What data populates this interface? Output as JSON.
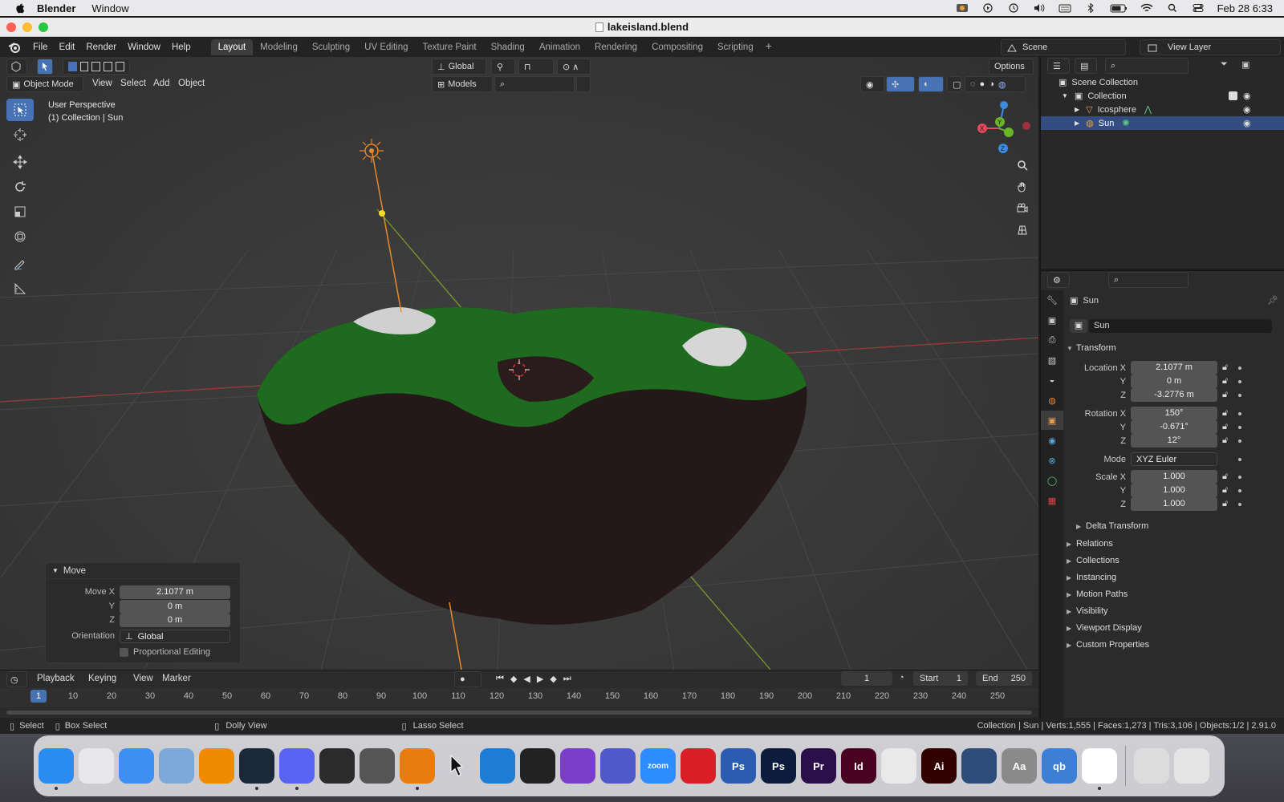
{
  "menubar": {
    "app_name": "Blender",
    "menus": [
      "Window"
    ],
    "clock": "Feb 28  6:33",
    "icons": [
      "flux-icon",
      "play-circle-icon",
      "time-machine-icon",
      "volume-icon",
      "keyboard-icon",
      "bluetooth-icon",
      "battery-icon",
      "wifi-icon",
      "search-icon",
      "control-center-icon"
    ]
  },
  "window": {
    "title": "lakeisland.blend"
  },
  "topbar": {
    "menus": [
      "File",
      "Edit",
      "Render",
      "Window",
      "Help"
    ],
    "workspaces": [
      "Layout",
      "Modeling",
      "Sculpting",
      "UV Editing",
      "Texture Paint",
      "Shading",
      "Animation",
      "Rendering",
      "Compositing",
      "Scripting"
    ],
    "active_workspace": "Layout",
    "scene": "Scene",
    "view_layer": "View Layer"
  },
  "viewport": {
    "mode": "Object Mode",
    "menus": [
      "View",
      "Select",
      "Add",
      "Object"
    ],
    "transform_orientation": "Global",
    "options_label": "Options",
    "collection_filter": "Models",
    "info_line1": "User Perspective",
    "info_line2": "(1) Collection | Sun",
    "gizmo_axes": {
      "x": "X",
      "y": "Y",
      "z": "Z"
    }
  },
  "move_panel": {
    "title": "Move",
    "move_x_label": "Move X",
    "move_x": "2.1077 m",
    "y_label": "Y",
    "y": "0 m",
    "z_label": "Z",
    "z": "0 m",
    "orientation_label": "Orientation",
    "orientation": "Global",
    "proportional_label": "Proportional Editing"
  },
  "timeline": {
    "menus": [
      "Playback",
      "Keying",
      "View",
      "Marker"
    ],
    "current_frame": "1",
    "start_label": "Start",
    "start": "1",
    "end_label": "End",
    "end": "250",
    "ruler": [
      "1",
      "10",
      "20",
      "30",
      "40",
      "50",
      "60",
      "70",
      "80",
      "90",
      "100",
      "110",
      "120",
      "130",
      "140",
      "150",
      "160",
      "170",
      "180",
      "190",
      "200",
      "210",
      "220",
      "230",
      "240",
      "250"
    ]
  },
  "statusbar": {
    "select": "Select",
    "box_select": "Box Select",
    "dolly": "Dolly View",
    "lasso": "Lasso Select",
    "stats": "Collection | Sun | Verts:1,555 | Faces:1,273 | Tris:3,106 | Objects:1/2 | 2.91.0"
  },
  "outliner": {
    "scene_collection": "Scene Collection",
    "collection": "Collection",
    "items": [
      "Icosphere",
      "Sun"
    ],
    "selected": "Sun"
  },
  "properties": {
    "object_name_header": "Sun",
    "object_name_field": "Sun",
    "transform_label": "Transform",
    "location_x_label": "Location X",
    "location_x": "2.1077 m",
    "location_y": "0 m",
    "location_z": "-3.2776 m",
    "rotation_x_label": "Rotation X",
    "rotation_x": "150°",
    "rotation_y": "-0.671°",
    "rotation_z": "12°",
    "mode_label": "Mode",
    "mode": "XYZ Euler",
    "scale_x_label": "Scale X",
    "scale_x": "1.000",
    "scale_y": "1.000",
    "scale_z": "1.000",
    "y_label": "Y",
    "z_label": "Z",
    "delta_transform": "Delta Transform",
    "sections": [
      "Relations",
      "Collections",
      "Instancing",
      "Motion Paths",
      "Visibility",
      "Viewport Display",
      "Custom Properties"
    ]
  },
  "dock": {
    "items": [
      {
        "name": "finder",
        "label": "",
        "color": "#2a8cf0"
      },
      {
        "name": "launchpad",
        "label": "",
        "color": "#e8e8ea"
      },
      {
        "name": "mail",
        "label": "",
        "color": "#3d8ff2"
      },
      {
        "name": "preview",
        "label": "",
        "color": "#7aa8d8"
      },
      {
        "name": "vlc",
        "label": "",
        "color": "#f08a00"
      },
      {
        "name": "steam",
        "label": "",
        "color": "#1b2838"
      },
      {
        "name": "discord",
        "label": "",
        "color": "#5865f2"
      },
      {
        "name": "sublime",
        "label": "",
        "color": "#2b2b2b"
      },
      {
        "name": "unity",
        "label": "",
        "color": "#555"
      },
      {
        "name": "blender",
        "label": "",
        "color": "#e87d0d"
      },
      {
        "name": "cursor",
        "label": "",
        "color": "transparent"
      },
      {
        "name": "vscode",
        "label": "",
        "color": "#1f7dd6"
      },
      {
        "name": "unity-hub",
        "label": "",
        "color": "#222"
      },
      {
        "name": "github",
        "label": "",
        "color": "#7a3ec9"
      },
      {
        "name": "teams",
        "label": "",
        "color": "#5059c9"
      },
      {
        "name": "zoom",
        "label": "zoom",
        "color": "#2d8cff"
      },
      {
        "name": "creative-cloud",
        "label": "",
        "color": "#da1f26"
      },
      {
        "name": "photoshop-express",
        "label": "Ps",
        "color": "#2a5db0"
      },
      {
        "name": "photoshop",
        "label": "Ps",
        "color": "#0c1c3c"
      },
      {
        "name": "premiere",
        "label": "Pr",
        "color": "#2a0f4a"
      },
      {
        "name": "indesign",
        "label": "Id",
        "color": "#49021f"
      },
      {
        "name": "acrobat",
        "label": "",
        "color": "#e9e9e9"
      },
      {
        "name": "illustrator",
        "label": "Ai",
        "color": "#330000"
      },
      {
        "name": "quicktime",
        "label": "",
        "color": "#2c4d7a"
      },
      {
        "name": "font-book",
        "label": "Aa",
        "color": "#8a8a8a"
      },
      {
        "name": "qbittorrent",
        "label": "qb",
        "color": "#3d7fd6"
      },
      {
        "name": "chrome",
        "label": "",
        "color": "#fff"
      },
      {
        "name": "downloads",
        "label": "",
        "color": "#dcdcdc"
      },
      {
        "name": "trash",
        "label": "",
        "color": "#e4e4e4"
      }
    ]
  }
}
